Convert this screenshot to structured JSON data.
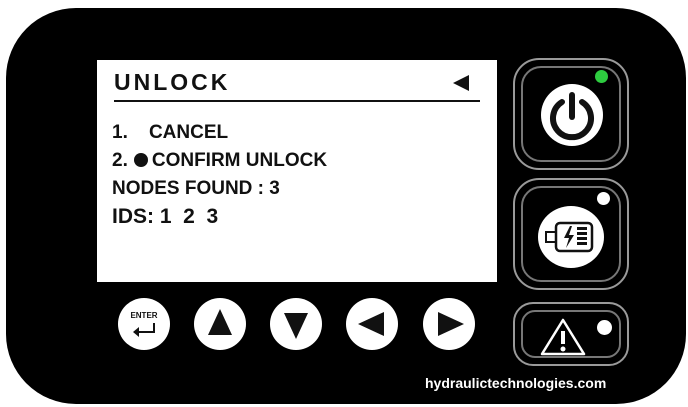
{
  "screen": {
    "title": "UNLOCK",
    "lines": [
      "1.    CANCEL",
      "CONFIRM UNLOCK",
      "NODES FOUND : 3",
      "IDS: 1  2  3"
    ],
    "line2_prefix": "2."
  },
  "buttons": {
    "enter_label": "ENTER",
    "power_led_color": "#2ecc40",
    "charge_led_color": "#ffffff",
    "warning_led_color": "#ffffff"
  },
  "brand": {
    "url": "hydraulictechnologies.com"
  }
}
